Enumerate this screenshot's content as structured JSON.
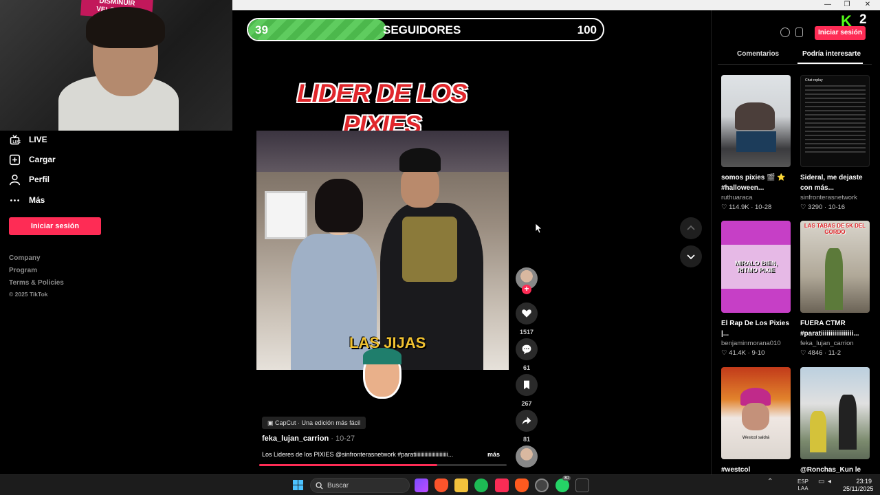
{
  "window": {
    "controls": [
      "—",
      "❐",
      "✕"
    ]
  },
  "webcam": {
    "sign_text": "DISMINUIR VELOCIDAD"
  },
  "sidebar": {
    "items": [
      {
        "label": "LIVE",
        "icon": "live-icon"
      },
      {
        "label": "Cargar",
        "icon": "upload-icon"
      },
      {
        "label": "Perfil",
        "icon": "profile-icon"
      },
      {
        "label": "Más",
        "icon": "more-icon"
      }
    ],
    "login_label": "Iniciar sesión",
    "footer": [
      "Company",
      "Program",
      "Terms & Policies",
      "© 2025 TikTok"
    ]
  },
  "follower_bar": {
    "current": "39",
    "label": "SEGUIDORES",
    "goal": "100",
    "progress": 0.39
  },
  "video": {
    "title_line1": "LIDER DE LOS",
    "title_line2": "PIXIES",
    "overlay_text": "LAS JIJAS",
    "capcut": "CapCut · Una edición más fácil",
    "author": "feka_lujan_carrion",
    "date": "· 10-27",
    "description": "Los Lideres de los PIXIES @sinfronterasnetwork  #paratiiiiiiiiiiiiiiiiiiiiiiii...",
    "more": "más",
    "progress": 0.72
  },
  "actions": {
    "likes": "1517",
    "comments": "61",
    "saves": "267",
    "shares": "81"
  },
  "right_panel": {
    "brand_num": "2",
    "login_label": "Iniciar sesión",
    "tabs": [
      "Comentarios",
      "Podría interesarte"
    ],
    "cards": [
      {
        "title": "somos pixies 🎬 ⭐ #halloween...",
        "user": "ruthuaraca",
        "likes": "114.9K",
        "date": "10-28",
        "thumb_text": ""
      },
      {
        "title": "Sideral, me dejaste con más...",
        "user": "sinfronterasnetwork",
        "likes": "3290",
        "date": "10-16",
        "thumb_text": "Chat replay"
      },
      {
        "title": "El Rap De Los Pixies |...",
        "user": "benjaminmorana010",
        "likes": "41.4K",
        "date": "9-10",
        "thumb_text": "MIRALO BIEN, RITMO PIXIE"
      },
      {
        "title": "FUERA CTMR #paratiiiiiiiiiiiiiiiii...",
        "user": "feka_lujan_carrion",
        "likes": "4846",
        "date": "11-2",
        "thumb_text": "LAS TABAS DE 5K DEL GORDO"
      },
      {
        "title": "#westcol",
        "user": "",
        "likes": "",
        "date": "",
        "thumb_text": "Westcol saldrá"
      },
      {
        "title": "@Ronchas_Kun le",
        "user": "",
        "likes": "",
        "date": "",
        "thumb_text": ""
      }
    ]
  },
  "taskbar": {
    "search_placeholder": "Buscar",
    "lang_line1": "ESP",
    "lang_line2": "LAA",
    "time": "23:19",
    "date": "25/11/2025",
    "whatsapp_badge": "30"
  }
}
